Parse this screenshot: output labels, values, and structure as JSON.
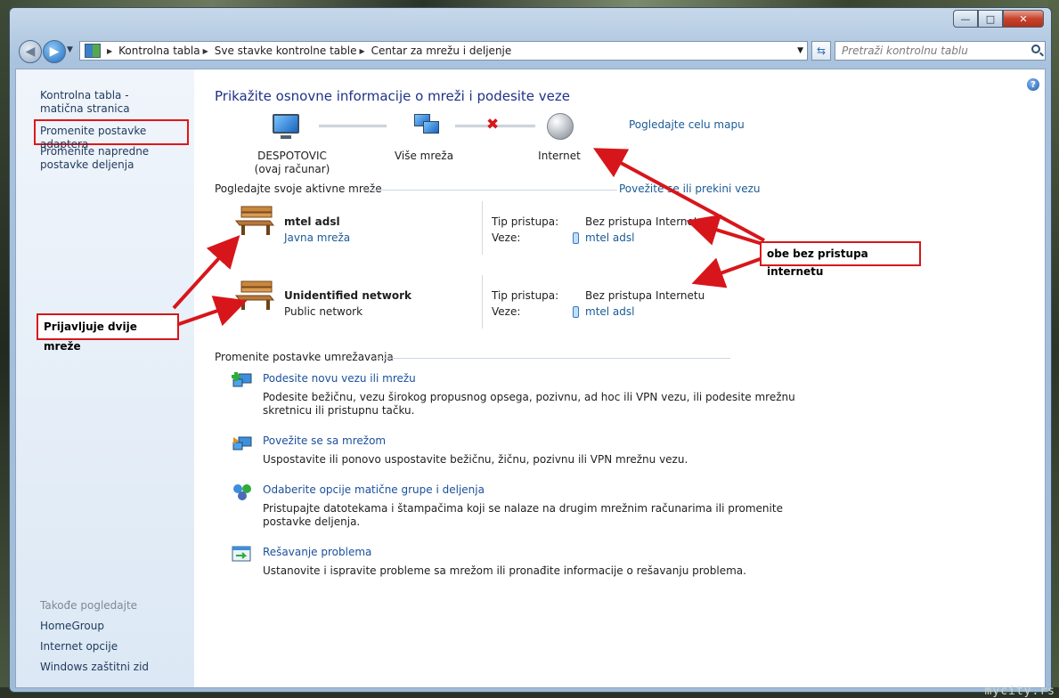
{
  "window": {
    "caption_buttons": {
      "minimize": "—",
      "maximize": "□",
      "close": "✕"
    }
  },
  "address_bar": {
    "breadcrumbs": [
      "Kontrolna tabla",
      "Sve stavke kontrolne table",
      "Centar za mrežu i deljenje"
    ],
    "search_placeholder": "Pretraži kontrolnu tablu"
  },
  "sidebar": {
    "items": [
      {
        "label": "Kontrolna tabla - matična stranica"
      },
      {
        "label": "Promenite postavke adaptera"
      },
      {
        "label": "Promenite napredne postavke deljenja"
      }
    ],
    "see_also_heading": "Takođe pogledajte",
    "see_also": [
      "HomeGroup",
      "Internet opcije",
      "Windows zaštitni zid"
    ]
  },
  "main": {
    "title": "Prikažite osnovne informacije o mreži i podesite veze",
    "see_full_map": "Pogledajte celu mapu",
    "network_map": {
      "computer_name": "DESPOTOVIC",
      "computer_sub": "(ovaj računar)",
      "middle_label": "Više mreža",
      "internet_label": "Internet"
    },
    "active_networks_heading": "Pogledajte svoje aktivne mreže",
    "connect_disconnect": "Povežite se ili prekini vezu",
    "networks": [
      {
        "name": "mtel adsl",
        "category": "Javna mreža",
        "access_label": "Tip pristupa:",
        "access_value": "Bez pristupa Internetu",
        "connections_label": "Veze:",
        "connection": "mtel adsl"
      },
      {
        "name": "Unidentified network",
        "category": "Public network",
        "access_label": "Tip pristupa:",
        "access_value": "Bez pristupa Internetu",
        "connections_label": "Veze:",
        "connection": "mtel adsl"
      }
    ],
    "change_settings_heading": "Promenite postavke umrežavanja",
    "tasks": [
      {
        "title": "Podesite novu vezu ili mrežu",
        "desc1": "Podesite bežičnu, vezu širokog propusnog opsega, pozivnu, ad hoc ili VPN vezu, ili podesite mrežnu",
        "desc2": "skretnicu ili pristupnu tačku."
      },
      {
        "title": "Povežite se sa mrežom",
        "desc1": "Uspostavite ili ponovo uspostavite bežičnu, žičnu, pozivnu ili VPN mrežnu vezu.",
        "desc2": ""
      },
      {
        "title": "Odaberite opcije matične grupe i deljenja",
        "desc1": "Pristupajte datotekama i štampačima koji se nalaze na drugim mrežnim računarima ili promenite",
        "desc2": "postavke deljenja."
      },
      {
        "title": "Rešavanje problema",
        "desc1": "Ustanovite i ispravite probleme sa mrežom ili pronađite informacije o rešavanju problema.",
        "desc2": ""
      }
    ]
  },
  "annotations": {
    "left_callout": "Prijavljuje dvije mreže",
    "right_callout": "obe bez pristupa internetu",
    "highlight_color": "#e1161b"
  },
  "watermark": "mycity.rs"
}
